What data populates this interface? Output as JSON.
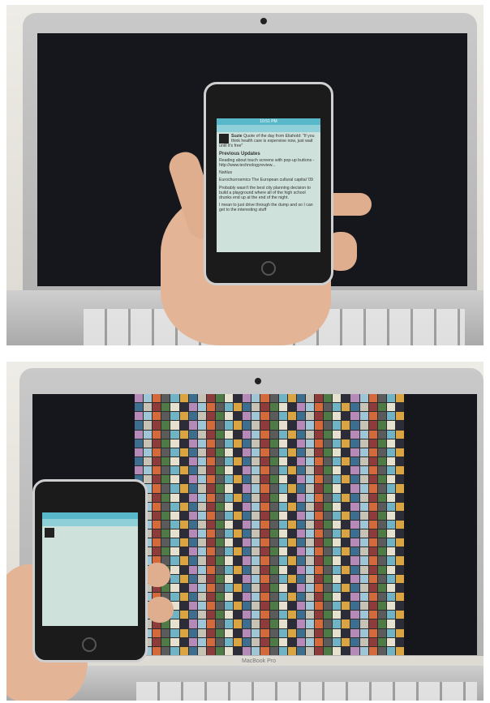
{
  "photos": [
    {
      "name": "laptop-blank-screen",
      "phone_screen": {
        "title": "",
        "featured_user": "Suzie",
        "featured_text": "Quote of the day from Eliahold: \"If you think health care is expensive now, just wait until it's free\"",
        "heading": "Previous Updates",
        "posts": [
          "Reading about touch screens with pop-up buttons - http://www.technologyreview...",
          "Nahlus",
          "Eurochurrosmics The European cultural capital '09",
          "Probably wasn't the best city planning decision to build a playground where all of the high school drunks end up at the end of the night.",
          "I mean to just drive through the dump and so I can get to the interesting stuff"
        ]
      }
    },
    {
      "name": "laptop-photo-mosaic",
      "phone_screen": {
        "title": "",
        "featured_user": "",
        "featured_text": "",
        "heading": "",
        "posts": []
      },
      "laptop_label": "MacBook Pro"
    }
  ],
  "colors": {
    "screen": "#15171c",
    "phone_status": "#58b8c9",
    "phone_bg": "#cfe1db",
    "skin": "#e3b596"
  },
  "mosaic_palette": [
    "#6fb3c4",
    "#d9a441",
    "#3e6e8f",
    "#c7c2b6",
    "#8e3b3b",
    "#4d7a45",
    "#e6e0cf",
    "#2d2d3a",
    "#b58ab8",
    "#9fc6d6",
    "#d46a3b",
    "#5b5b5b"
  ]
}
